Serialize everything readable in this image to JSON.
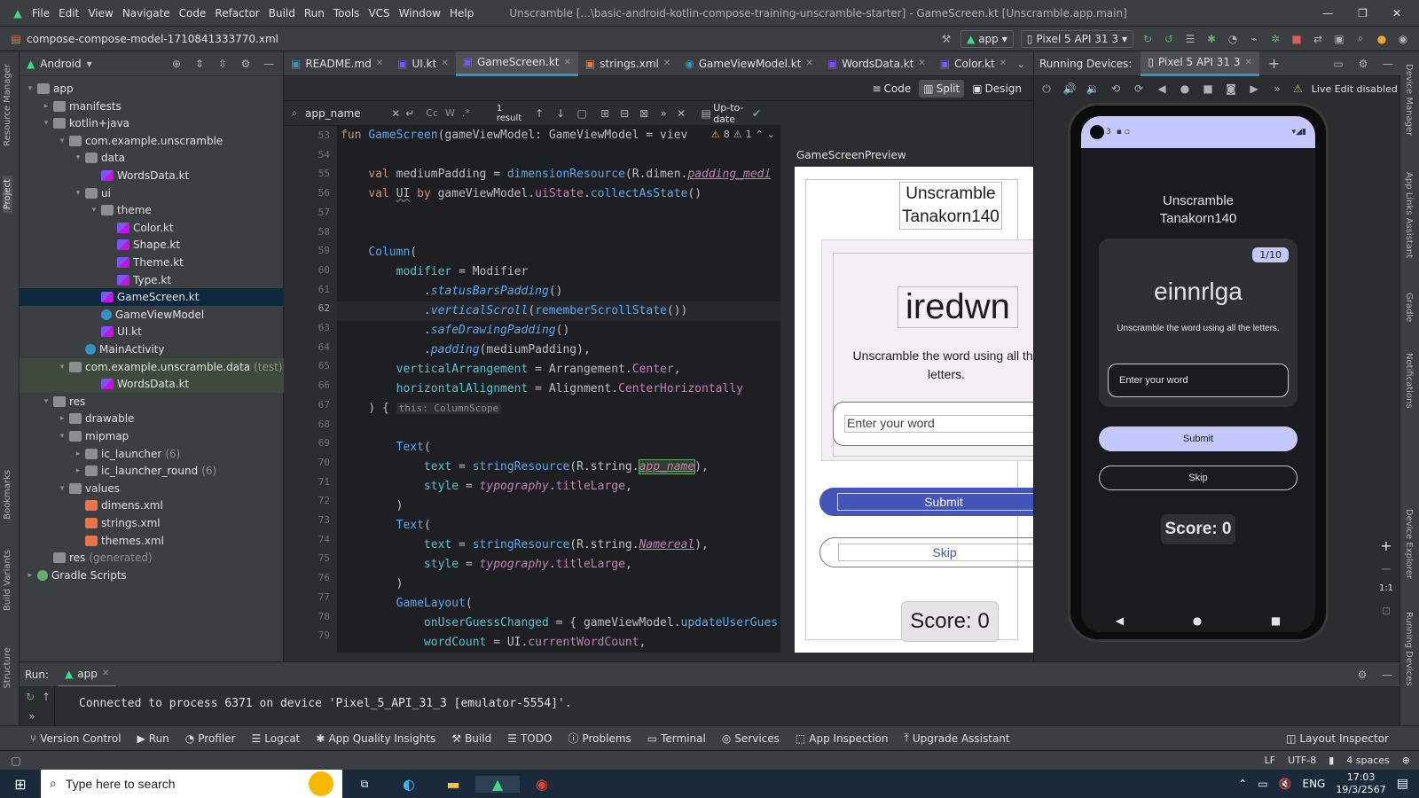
{
  "menubar": {
    "items": [
      "File",
      "Edit",
      "View",
      "Navigate",
      "Code",
      "Refactor",
      "Build",
      "Run",
      "Tools",
      "VCS",
      "Window",
      "Help"
    ],
    "title": "Unscramble [...\\basic-android-kotlin-compose-training-unscramble-starter] - GameScreen.kt [Unscramble.app.main]"
  },
  "navbar": {
    "file": "compose-compose-model-1710841333770.xml",
    "run_config": "app",
    "device": "Pixel 5 API 31 3"
  },
  "left_strip": [
    "Resource Manager",
    "Project",
    "Bookmarks",
    "Build Variants",
    "Structure"
  ],
  "right_strip": [
    "Device Manager",
    "App Links Assistant",
    "Gradle",
    "Notifications",
    "Device Explorer",
    "Running Devices"
  ],
  "project": {
    "view": "Android",
    "tree": [
      {
        "label": "app",
        "depth": 0,
        "icon": "folder",
        "arrow": "down"
      },
      {
        "label": "manifests",
        "depth": 1,
        "icon": "folder",
        "arrow": "right"
      },
      {
        "label": "kotlin+java",
        "depth": 1,
        "icon": "folder",
        "arrow": "down"
      },
      {
        "label": "com.example.unscramble",
        "depth": 2,
        "icon": "folder",
        "arrow": "down"
      },
      {
        "label": "data",
        "depth": 3,
        "icon": "folder",
        "arrow": "down"
      },
      {
        "label": "WordsData.kt",
        "depth": 4,
        "icon": "kt"
      },
      {
        "label": "ui",
        "depth": 3,
        "icon": "folder",
        "arrow": "down"
      },
      {
        "label": "theme",
        "depth": 4,
        "icon": "folder",
        "arrow": "down"
      },
      {
        "label": "Color.kt",
        "depth": 5,
        "icon": "kt"
      },
      {
        "label": "Shape.kt",
        "depth": 5,
        "icon": "kt"
      },
      {
        "label": "Theme.kt",
        "depth": 5,
        "icon": "kt"
      },
      {
        "label": "Type.kt",
        "depth": 5,
        "icon": "kt"
      },
      {
        "label": "GameScreen.kt",
        "depth": 4,
        "icon": "kt",
        "state": "sel"
      },
      {
        "label": "GameViewModel",
        "depth": 4,
        "icon": "class"
      },
      {
        "label": "UI.kt",
        "depth": 4,
        "icon": "kt"
      },
      {
        "label": "MainActivity",
        "depth": 3,
        "icon": "class"
      },
      {
        "label": "com.example.unscramble.data",
        "suffix": "(test)",
        "depth": 2,
        "icon": "folder",
        "arrow": "down",
        "state": "hl"
      },
      {
        "label": "WordsData.kt",
        "depth": 4,
        "icon": "kt",
        "state": "hl"
      },
      {
        "label": "res",
        "depth": 1,
        "icon": "folder",
        "arrow": "down"
      },
      {
        "label": "drawable",
        "depth": 2,
        "icon": "folder",
        "arrow": "right"
      },
      {
        "label": "mipmap",
        "depth": 2,
        "icon": "folder",
        "arrow": "down"
      },
      {
        "label": "ic_launcher",
        "suffix": "(6)",
        "depth": 3,
        "icon": "folder",
        "arrow": "right"
      },
      {
        "label": "ic_launcher_round",
        "suffix": "(6)",
        "depth": 3,
        "icon": "folder",
        "arrow": "right"
      },
      {
        "label": "values",
        "depth": 2,
        "icon": "folder",
        "arrow": "down"
      },
      {
        "label": "dimens.xml",
        "depth": 3,
        "icon": "xml"
      },
      {
        "label": "strings.xml",
        "depth": 3,
        "icon": "xml"
      },
      {
        "label": "themes.xml",
        "depth": 3,
        "icon": "xml"
      },
      {
        "label": "res",
        "suffix": "(generated)",
        "depth": 1,
        "icon": "folder"
      },
      {
        "label": "Gradle Scripts",
        "depth": 0,
        "icon": "gradle",
        "arrow": "right"
      }
    ]
  },
  "editor": {
    "tabs": [
      {
        "label": "README.md",
        "icon": "md"
      },
      {
        "label": "UI.kt",
        "icon": "kt"
      },
      {
        "label": "GameScreen.kt",
        "icon": "kt",
        "active": true
      },
      {
        "label": "strings.xml",
        "icon": "xml"
      },
      {
        "label": "GameViewModel.kt",
        "icon": "class"
      },
      {
        "label": "WordsData.kt",
        "icon": "kt"
      },
      {
        "label": "Color.kt",
        "icon": "kt"
      }
    ],
    "modes": [
      "Code",
      "Split",
      "Design"
    ],
    "active_mode": "Split",
    "search_text": "app_name",
    "result_count": "1 result",
    "status": "Up-to-date",
    "warnings": "8",
    "weak_warnings": "1",
    "line_numbers": [
      "53",
      "54",
      "55",
      "56",
      "57",
      "58",
      "59",
      "60",
      "61",
      "62",
      "63",
      "64",
      "65",
      "66",
      "67",
      "68",
      "69",
      "70",
      "71",
      "72",
      "73",
      "74",
      "75",
      "76",
      "77",
      "78",
      "79"
    ],
    "current_line": "62"
  },
  "preview": {
    "label": "GameScreenPreview",
    "title_line1": "Unscramble",
    "title_line2": "Tanakorn140",
    "word": "iredwn",
    "instructions": "Unscramble the word using all the letters.",
    "input_placeholder": "Enter your word",
    "submit": "Submit",
    "skip": "Skip",
    "score": "Score: 0"
  },
  "running_devices": {
    "label": "Running Devices:",
    "device_tab": "Pixel 5 API 31 3",
    "live_edit": "Live Edit disabled",
    "zoom_label": "1:1"
  },
  "phone": {
    "status_time": "3",
    "title_line1": "Unscramble",
    "title_line2": "Tanakorn140",
    "counter": "1/10",
    "word": "einnrlga",
    "instructions": "Unscramble the word using all the letters.",
    "input_placeholder": "Enter your word",
    "submit": "Submit",
    "skip": "Skip",
    "score": "Score: 0"
  },
  "run": {
    "label": "Run:",
    "config": "app",
    "console": "Connected to process 6371 on device 'Pixel_5_API_31_3 [emulator-5554]'."
  },
  "toolwindows": [
    "Version Control",
    "Run",
    "Profiler",
    "Logcat",
    "App Quality Insights",
    "Build",
    "TODO",
    "Problems",
    "Terminal",
    "Services",
    "App Inspection",
    "Upgrade Assistant"
  ],
  "layout_inspector": "Layout Inspector",
  "statusbar": {
    "line_sep": "LF",
    "encoding": "UTF-8",
    "indent": "4 spaces"
  },
  "taskbar": {
    "search_placeholder": "Type here to search",
    "lang": "ENG",
    "time": "17:03",
    "date": "19/3/2567"
  },
  "colors": {
    "accent": "#3592c4",
    "phone_button": "#c5c8ff",
    "preview_button": "#4355b9"
  }
}
